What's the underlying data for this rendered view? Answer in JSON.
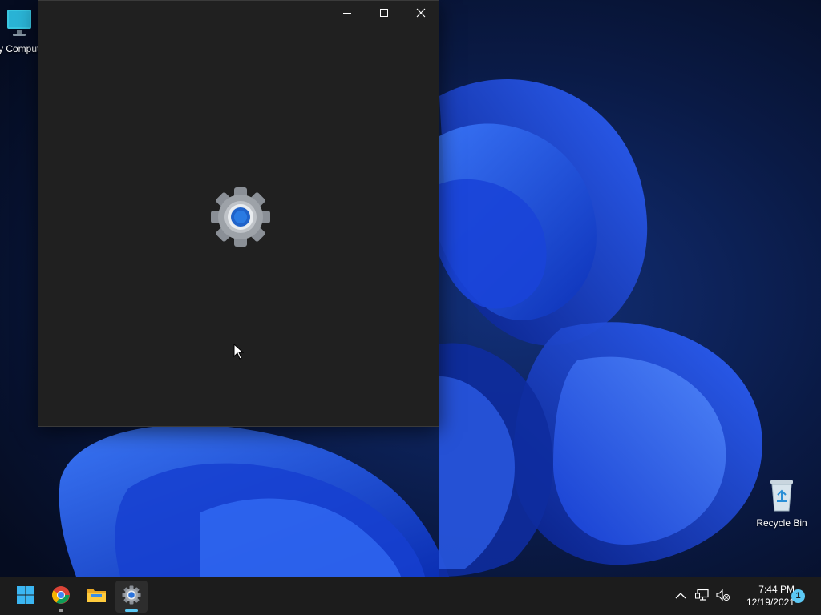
{
  "desktop": {
    "icons": [
      {
        "label": "My Computer",
        "icon": "computer-icon"
      },
      {
        "label": "Recycle Bin",
        "icon": "recycle-bin-icon"
      }
    ]
  },
  "window": {
    "app": "Settings",
    "splash_icon": "gear-icon",
    "buttons": {
      "minimize": "minimize-icon",
      "maximize": "maximize-icon",
      "close": "close-icon"
    }
  },
  "taskbar": {
    "apps": [
      {
        "icon": "windows-start-icon"
      },
      {
        "icon": "chrome-icon",
        "running": true
      },
      {
        "icon": "file-explorer-icon"
      },
      {
        "icon": "settings-gear-icon",
        "active": true
      }
    ],
    "tray": {
      "chevron": "chevron-up-icon",
      "network": "network-icon",
      "volume": "volume-muted-icon"
    },
    "clock": {
      "time": "7:44 PM",
      "date": "12/19/2021"
    },
    "notification_count": "1"
  },
  "colors": {
    "accent": "#5cc9f5",
    "window_bg": "#202020",
    "taskbar_bg": "#1c1c1c"
  }
}
